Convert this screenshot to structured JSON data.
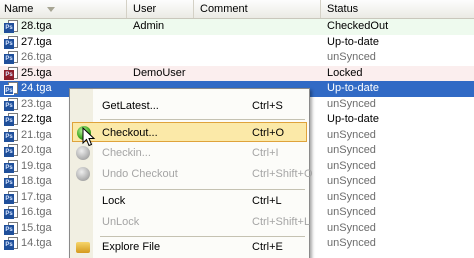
{
  "header": {
    "name": "Name",
    "user": "User",
    "comment": "Comment",
    "status": "Status"
  },
  "rows": [
    {
      "name": "28.tga",
      "user": "Admin",
      "status": "CheckedOut",
      "style": "green"
    },
    {
      "name": "27.tga",
      "user": "",
      "status": "Up-to-date",
      "style": "normal"
    },
    {
      "name": "26.tga",
      "user": "",
      "status": "unSynced",
      "style": "grey"
    },
    {
      "name": "25.tga",
      "user": "DemoUser",
      "status": "Locked",
      "style": "red"
    },
    {
      "name": "24.tga",
      "user": "",
      "status": "Up-to-date",
      "style": "selected"
    },
    {
      "name": "23.tga",
      "user": "",
      "status": "unSynced",
      "style": "grey"
    },
    {
      "name": "22.tga",
      "user": "",
      "status": "Up-to-date",
      "style": "normal"
    },
    {
      "name": "21.tga",
      "user": "",
      "status": "unSynced",
      "style": "grey"
    },
    {
      "name": "20.tga",
      "user": "",
      "status": "unSynced",
      "style": "grey"
    },
    {
      "name": "19.tga",
      "user": "",
      "status": "unSynced",
      "style": "grey"
    },
    {
      "name": "18.tga",
      "user": "",
      "status": "unSynced",
      "style": "grey"
    },
    {
      "name": "17.tga",
      "user": "",
      "status": "unSynced",
      "style": "grey"
    },
    {
      "name": "16.tga",
      "user": "",
      "status": "unSynced",
      "style": "grey"
    },
    {
      "name": "15.tga",
      "user": "",
      "status": "unSynced",
      "style": "grey"
    },
    {
      "name": "14.tga",
      "user": "",
      "status": "unSynced",
      "style": "grey"
    }
  ],
  "menu": {
    "items": [
      {
        "label": "GetLatest...",
        "accel": "Ctrl+S",
        "icon": "none",
        "disabled": false
      },
      {
        "label": "Checkout...",
        "accel": "Ctrl+O",
        "icon": "checkout-green-icon",
        "disabled": false,
        "hover": true
      },
      {
        "label": "Checkin...",
        "accel": "Ctrl+I",
        "icon": "checkin-grey-icon",
        "disabled": true
      },
      {
        "label": "Undo Checkout",
        "accel": "Ctrl+Shift+O",
        "icon": "undo-grey-icon",
        "disabled": true
      },
      {
        "label": "Lock",
        "accel": "Ctrl+L",
        "icon": "none",
        "disabled": false
      },
      {
        "label": "UnLock",
        "accel": "Ctrl+Shift+L",
        "icon": "none",
        "disabled": true
      },
      {
        "label": "Explore File",
        "accel": "Ctrl+E",
        "icon": "folder-icon",
        "disabled": false
      }
    ]
  },
  "colors": {
    "selection": "#316ac5",
    "hover_fill": "#fbe9a8",
    "hover_border": "#dfa33b",
    "checked_out_row": "#eefaee",
    "locked_row": "#fbeeee"
  }
}
